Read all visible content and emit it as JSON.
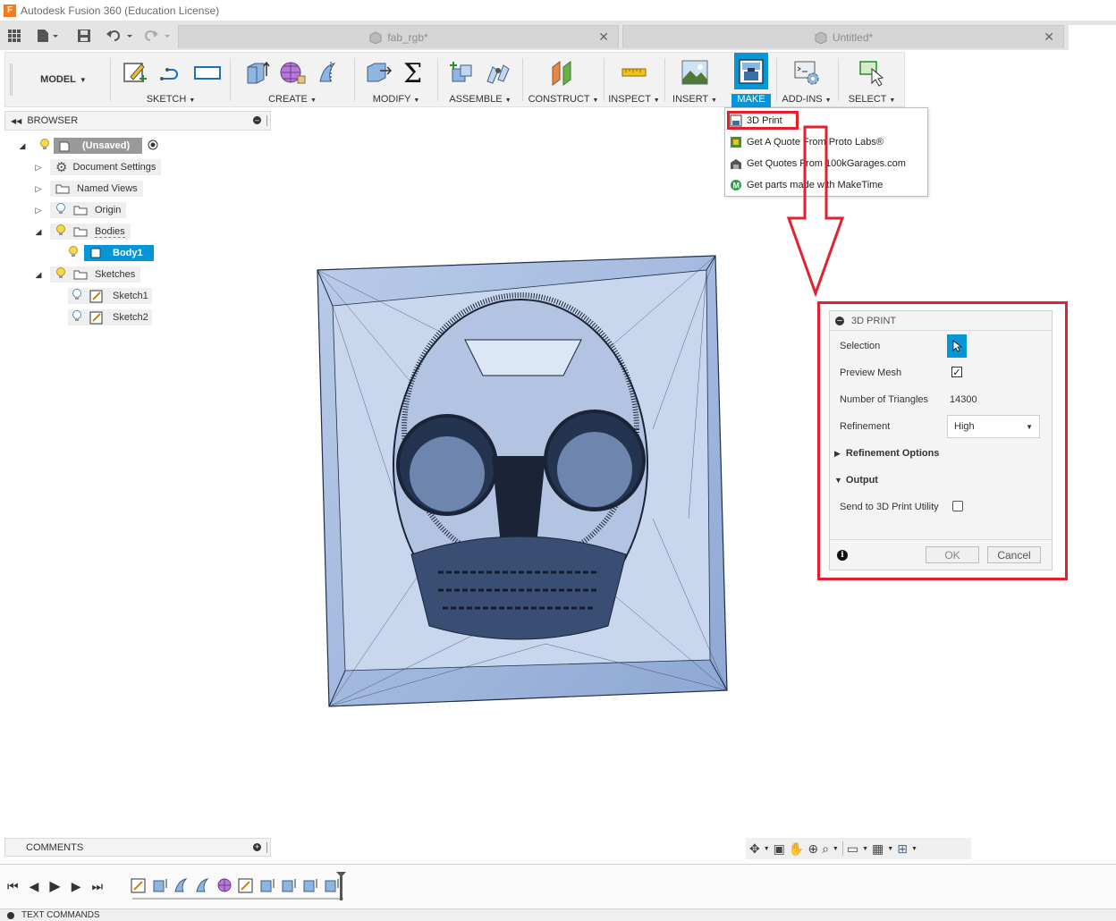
{
  "window": {
    "title": "Autodesk Fusion 360 (Education License)",
    "logo_letter": "F"
  },
  "tabs": [
    {
      "label": "fab_rgb*"
    },
    {
      "label": "Untitled*"
    }
  ],
  "toolbar": {
    "workspace": "MODEL",
    "groups": [
      "SKETCH",
      "CREATE",
      "MODIFY",
      "ASSEMBLE",
      "CONSTRUCT",
      "INSPECT",
      "INSERT",
      "MAKE",
      "ADD-INS",
      "SELECT"
    ],
    "make_accent": "#0696d7"
  },
  "make_menu": {
    "items": [
      {
        "label": "3D Print"
      },
      {
        "label": "Get A Quote From Proto Labs®"
      },
      {
        "label": "Get Quotes From 100kGarages.com"
      },
      {
        "label": "Get parts made with MakeTime"
      }
    ]
  },
  "browser": {
    "title": "BROWSER",
    "root": "(Unsaved)",
    "items": [
      {
        "label": "Document Settings"
      },
      {
        "label": "Named Views"
      },
      {
        "label": "Origin"
      },
      {
        "label": "Bodies"
      },
      {
        "label": "Body1"
      },
      {
        "label": "Sketches"
      },
      {
        "label": "Sketch1"
      },
      {
        "label": "Sketch2"
      }
    ]
  },
  "print_panel": {
    "title": "3D PRINT",
    "selection_label": "Selection",
    "preview_label": "Preview Mesh",
    "preview_checked": true,
    "triangles_label": "Number of Triangles",
    "triangles_value": "14300",
    "refinement_label": "Refinement",
    "refinement_value": "High",
    "refinement_options": "Refinement Options",
    "output": "Output",
    "send_label": "Send to 3D Print Utility",
    "send_checked": false,
    "ok": "OK",
    "cancel": "Cancel"
  },
  "annotation_color": "#e5202e",
  "comments": {
    "title": "COMMENTS"
  },
  "text_commands": {
    "title": "TEXT COMMANDS"
  }
}
